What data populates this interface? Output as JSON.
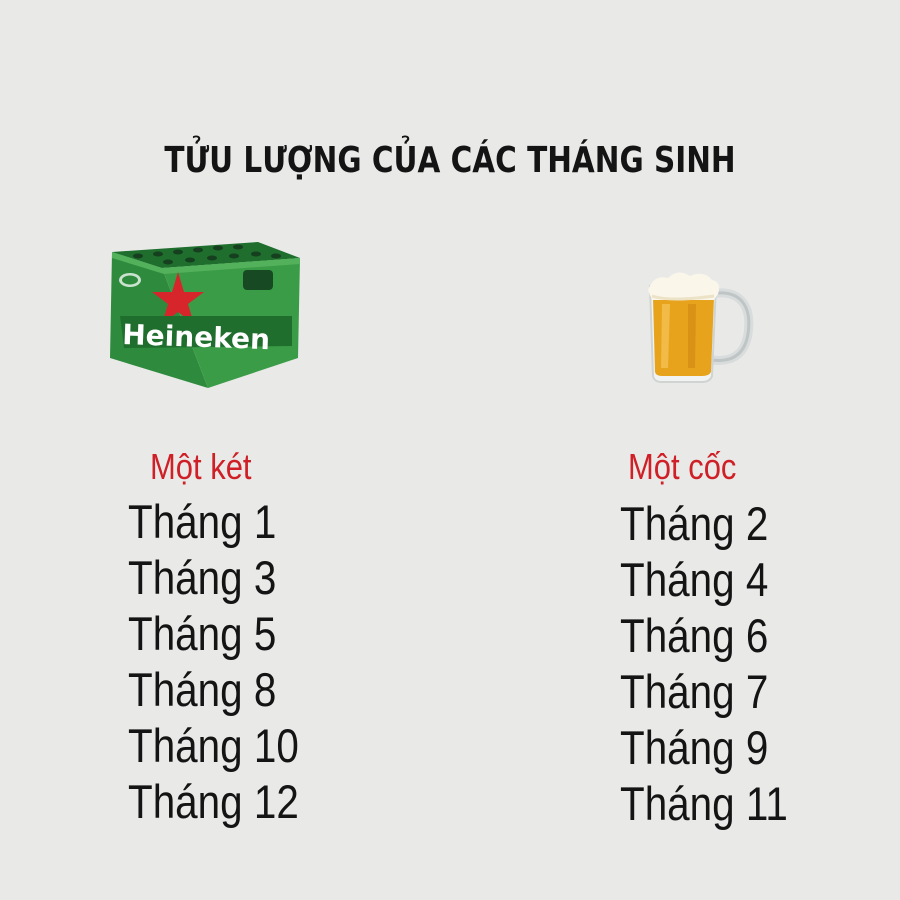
{
  "title": "TỬU LƯỢNG CỦA CÁC THÁNG SINH",
  "images": {
    "left": {
      "icon": "beer-crate-icon",
      "logo_text": "Heineken",
      "color": "#2e8b3d",
      "star_color": "#d6262b"
    },
    "right": {
      "icon": "beer-mug-icon",
      "beer_color": "#e8a31c"
    }
  },
  "left": {
    "heading": "Một két",
    "months": [
      "Tháng 1",
      "Tháng 3",
      "Tháng 5",
      "Tháng 8",
      "Tháng 10",
      "Tháng 12"
    ]
  },
  "right": {
    "heading": "Một cốc",
    "months": [
      "Tháng 2",
      "Tháng 4",
      "Tháng 6",
      "Tháng 7",
      "Tháng 9",
      "Tháng 11"
    ]
  },
  "colors": {
    "background": "#e9eae8",
    "heading": "#cf2027",
    "text": "#141414"
  }
}
